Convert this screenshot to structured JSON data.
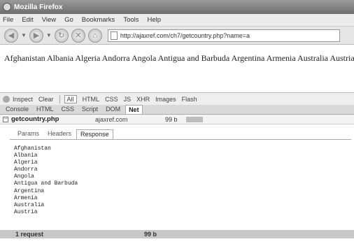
{
  "window": {
    "title": "Mozilla Firefox"
  },
  "menu": [
    "File",
    "Edit",
    "View",
    "Go",
    "Bookmarks",
    "Tools",
    "Help"
  ],
  "nav": {
    "url": "http://ajaxref.com/ch7/getcountry.php?name=a"
  },
  "page": {
    "text": "Afghanistan Albania Algeria Andorra Angola Antigua and Barbuda Argentina Armenia Australia Austria"
  },
  "firebug": {
    "toolbar": [
      "Inspect",
      "Clear",
      "All",
      "HTML",
      "CSS",
      "JS",
      "XHR",
      "Images",
      "Flash"
    ],
    "tabs": [
      "Console",
      "HTML",
      "CSS",
      "Script",
      "DOM",
      "Net"
    ],
    "request": {
      "file": "getcountry.php",
      "domain": "ajaxref.com",
      "size": "99 b"
    },
    "info_tabs": [
      "Params",
      "Headers",
      "Response"
    ],
    "response_lines": [
      "Afghanistan",
      "Albania",
      "Algeria",
      "Andorra",
      "Angola",
      "Antigua and Barbuda",
      "Argentina",
      "Armenia",
      "Australia",
      "Austria"
    ],
    "status": {
      "requests": "1 request",
      "size": "99 b"
    }
  }
}
